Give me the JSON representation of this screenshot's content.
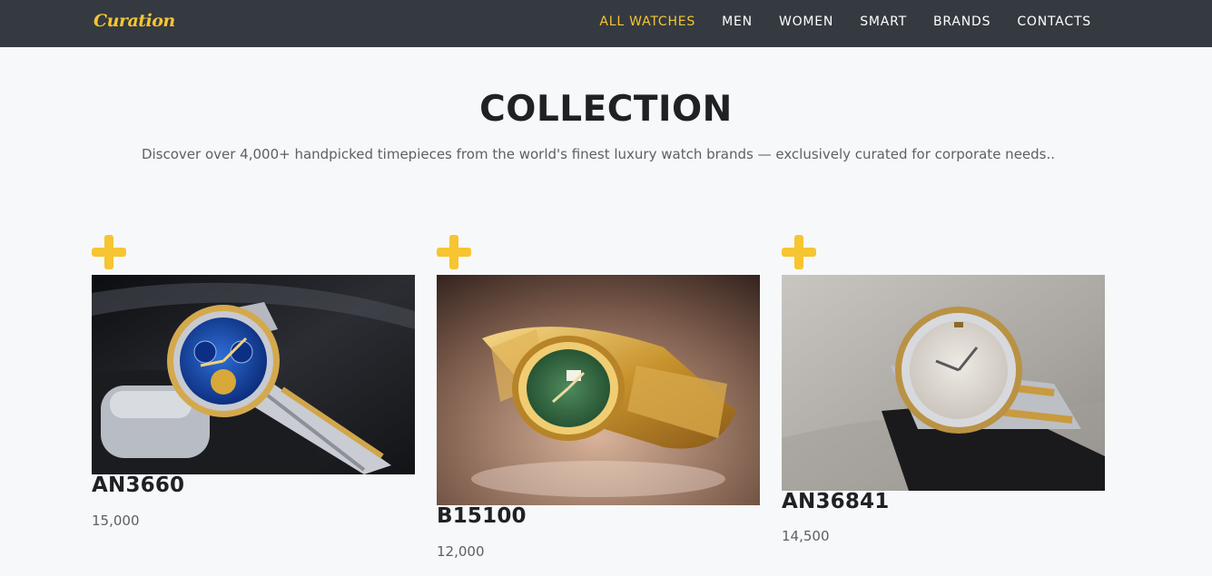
{
  "nav": {
    "brand": "Curation",
    "links": [
      {
        "label": "ALL WATCHES",
        "active": true
      },
      {
        "label": "MEN"
      },
      {
        "label": "WOMEN"
      },
      {
        "label": "SMART"
      },
      {
        "label": "BRANDS"
      },
      {
        "label": "CONTACTS"
      }
    ]
  },
  "hero": {
    "title": "COLLECTION",
    "subtitle": "Discover over 4,000+ handpicked timepieces from the world's finest luxury watch brands — exclusively curated for corporate needs.."
  },
  "products": [
    {
      "name": "AN3660",
      "price": "15,000",
      "image": "blue-dial-two-tone-chronograph-watch",
      "add_icon": "plus-icon"
    },
    {
      "name": "B15100",
      "price": "12,000",
      "image": "gold-watch-green-dial",
      "add_icon": "plus-icon"
    },
    {
      "name": "AN36841",
      "price": "14,500",
      "image": "two-tone-silver-dial-watch",
      "add_icon": "plus-icon"
    }
  ],
  "colors": {
    "accent": "#f6c531",
    "navbar_bg": "#343a40",
    "page_bg": "#f7f8fa",
    "text_dark": "#1f2124",
    "text_muted": "#5c6166"
  }
}
